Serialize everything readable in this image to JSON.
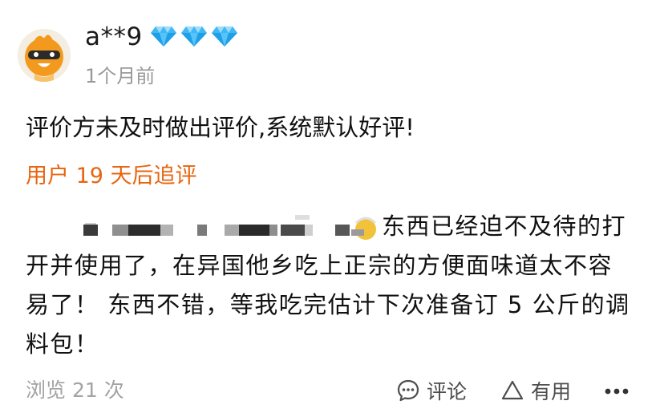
{
  "review": {
    "user": {
      "name": "a**9",
      "avatar_icon": "orange-bird-mascot-icon",
      "level_icon": "diamond-icon",
      "level_diamonds": 3,
      "level_color": "#3fb8f5"
    },
    "time": "1个月前",
    "default_text": "评价方未及时做出评价,系统默认好评!",
    "followup": {
      "label": "用户 19 天后追评",
      "label_color": "#e8640f",
      "line1_tail": "东西已经迫不及待的打",
      "line2": "开并使用了，在异国他乡吃上正宗的方便面味道太不容",
      "line3": "易了！  东西不错，等我吃完估计下次准备订 5 公斤的调",
      "line4": "料包！",
      "redacted_icon": "pixelated-redaction",
      "emoji_icon": "emoji-face-icon"
    },
    "footer": {
      "views": "浏览 21 次",
      "comment_icon": "chat-bubble-icon",
      "comment_label": "评论",
      "useful_icon": "triangle-up-icon",
      "useful_label": "有用",
      "more_icon": "more-dots-icon"
    }
  }
}
